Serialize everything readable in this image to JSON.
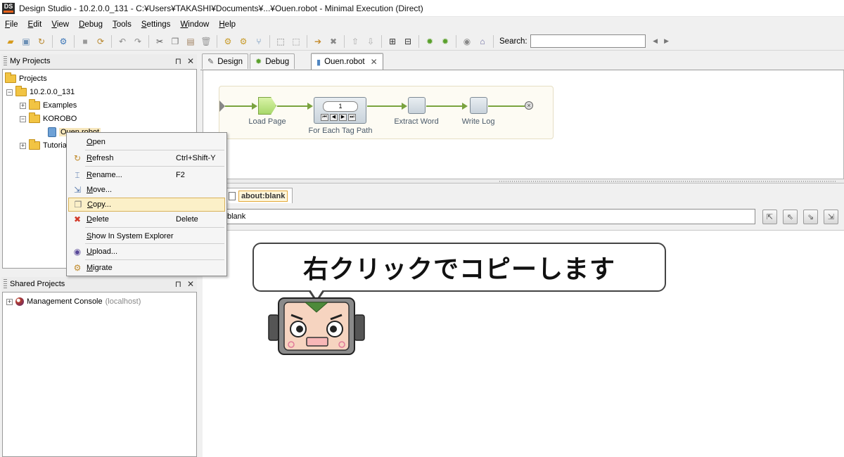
{
  "window": {
    "title": "Design Studio - 10.2.0.0_131 - C:¥Users¥TAKASHI¥Documents¥...¥Ouen.robot - Minimal Execution (Direct)",
    "logo": "DS"
  },
  "menu": [
    {
      "label": "File",
      "u": "F",
      "rest": "ile"
    },
    {
      "label": "Edit",
      "u": "E",
      "rest": "dit"
    },
    {
      "label": "View",
      "u": "V",
      "rest": "iew"
    },
    {
      "label": "Debug",
      "u": "D",
      "rest": "ebug"
    },
    {
      "label": "Tools",
      "u": "T",
      "rest": "ools"
    },
    {
      "label": "Settings",
      "u": "S",
      "rest": "ettings"
    },
    {
      "label": "Window",
      "u": "W",
      "rest": "indow"
    },
    {
      "label": "Help",
      "u": "H",
      "rest": "elp"
    }
  ],
  "toolbar": {
    "search_label": "Search:",
    "search_value": "",
    "prev": "◀",
    "next": "▶"
  },
  "my_projects": {
    "title": "My Projects",
    "pin": "⊓",
    "close": "✕",
    "tree": {
      "root": "Projects",
      "project": "10.2.0.0_131",
      "examples": "Examples",
      "korobo": "KOROBO",
      "robot": "Ouen.robot",
      "tutorials": "Tutorials"
    }
  },
  "shared_projects": {
    "title": "Shared Projects",
    "pin": "⊓",
    "close": "✕",
    "item": "Management Console",
    "host": "(localhost)"
  },
  "tabs": [
    {
      "label": "Design",
      "icon": "pencil-icon"
    },
    {
      "label": "Debug",
      "icon": "bug-icon"
    },
    {
      "label": "Ouen.robot",
      "icon": "robot-icon",
      "close": "✕"
    }
  ],
  "flow": {
    "steps": [
      "Load Page",
      "For Each Tag Path",
      "Extract Word",
      "Write Log"
    ],
    "loop_counter": "1"
  },
  "browser": {
    "tab_label": "about:blank",
    "url": "blank"
  },
  "context_menu": [
    {
      "label": "Open",
      "u": "O",
      "rest": "pen",
      "shortcut": "",
      "icon": ""
    },
    {
      "label": "Refresh",
      "u": "R",
      "rest": "efresh",
      "shortcut": "Ctrl+Shift-Y",
      "icon": "refresh-icon"
    },
    {
      "label": "Rename...",
      "u": "R",
      "rest": "ename...",
      "shortcut": "F2",
      "icon": "rename-icon"
    },
    {
      "label": "Move...",
      "u": "M",
      "rest": "ove...",
      "shortcut": "",
      "icon": "move-icon"
    },
    {
      "label": "Copy...",
      "u": "C",
      "rest": "opy...",
      "shortcut": "",
      "icon": "copy-icon"
    },
    {
      "label": "Delete",
      "u": "D",
      "rest": "elete",
      "shortcut": "Delete",
      "icon": "delete-icon"
    },
    {
      "label": "Show In System Explorer",
      "u": "S",
      "rest": "how In System Explorer",
      "shortcut": "",
      "icon": ""
    },
    {
      "label": "Upload...",
      "u": "U",
      "rest": "pload...",
      "shortcut": "",
      "icon": "upload-icon"
    },
    {
      "label": "Migrate",
      "u": "M",
      "rest": "igrate",
      "shortcut": "",
      "icon": "migrate-icon"
    }
  ],
  "annotation": {
    "text": "右クリックでコピーします"
  },
  "colors": {
    "highlight": "#fbf0c8",
    "flow_line": "#7aa33f",
    "load_page": "#b9e27a"
  }
}
